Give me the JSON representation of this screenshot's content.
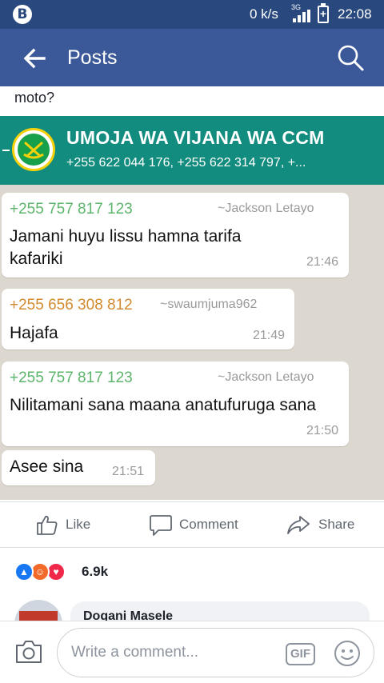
{
  "status_bar": {
    "logo": "B",
    "network_speed": "0 k/s",
    "network_type": "3G",
    "battery_symbol": "+",
    "time": "22:08"
  },
  "app_bar": {
    "title": "Posts"
  },
  "post": {
    "text": "moto?",
    "screenshot": {
      "group_title": "UMOJA WA VIJANA  WA CCM",
      "group_members": "+255 622 044 176, +255 622 314 797, +...",
      "messages": [
        {
          "phone": "+255 757 817 123",
          "alias": "~Jackson Letayo",
          "text": "Jamani huyu lissu hamna tarifa kafariki",
          "time": "21:46"
        },
        {
          "phone": "+255 656 308 812",
          "alias": "~swaumjuma962",
          "text": "Hajafa",
          "time": "21:49"
        },
        {
          "phone": "+255 757 817 123",
          "alias": "~Jackson Letayo",
          "text": "Nilitamani sana maana anatufuruga sana",
          "time": "21:50"
        },
        {
          "phone": "",
          "alias": "",
          "text": "Asee sina",
          "time": "21:51"
        }
      ]
    }
  },
  "actions": {
    "like": "Like",
    "comment": "Comment",
    "share": "Share"
  },
  "reactions": {
    "count": "6.9k"
  },
  "comment_preview": {
    "author": "Dogani Masele"
  },
  "composer": {
    "placeholder": "Write a comment...",
    "gif_label": "GIF"
  },
  "colors": {
    "facebook_blue": "#3b5998",
    "status_bar": "#29487d",
    "whatsapp_header": "#128c7e",
    "phone_green": "#5cb56b",
    "phone_orange": "#d48a2e"
  }
}
